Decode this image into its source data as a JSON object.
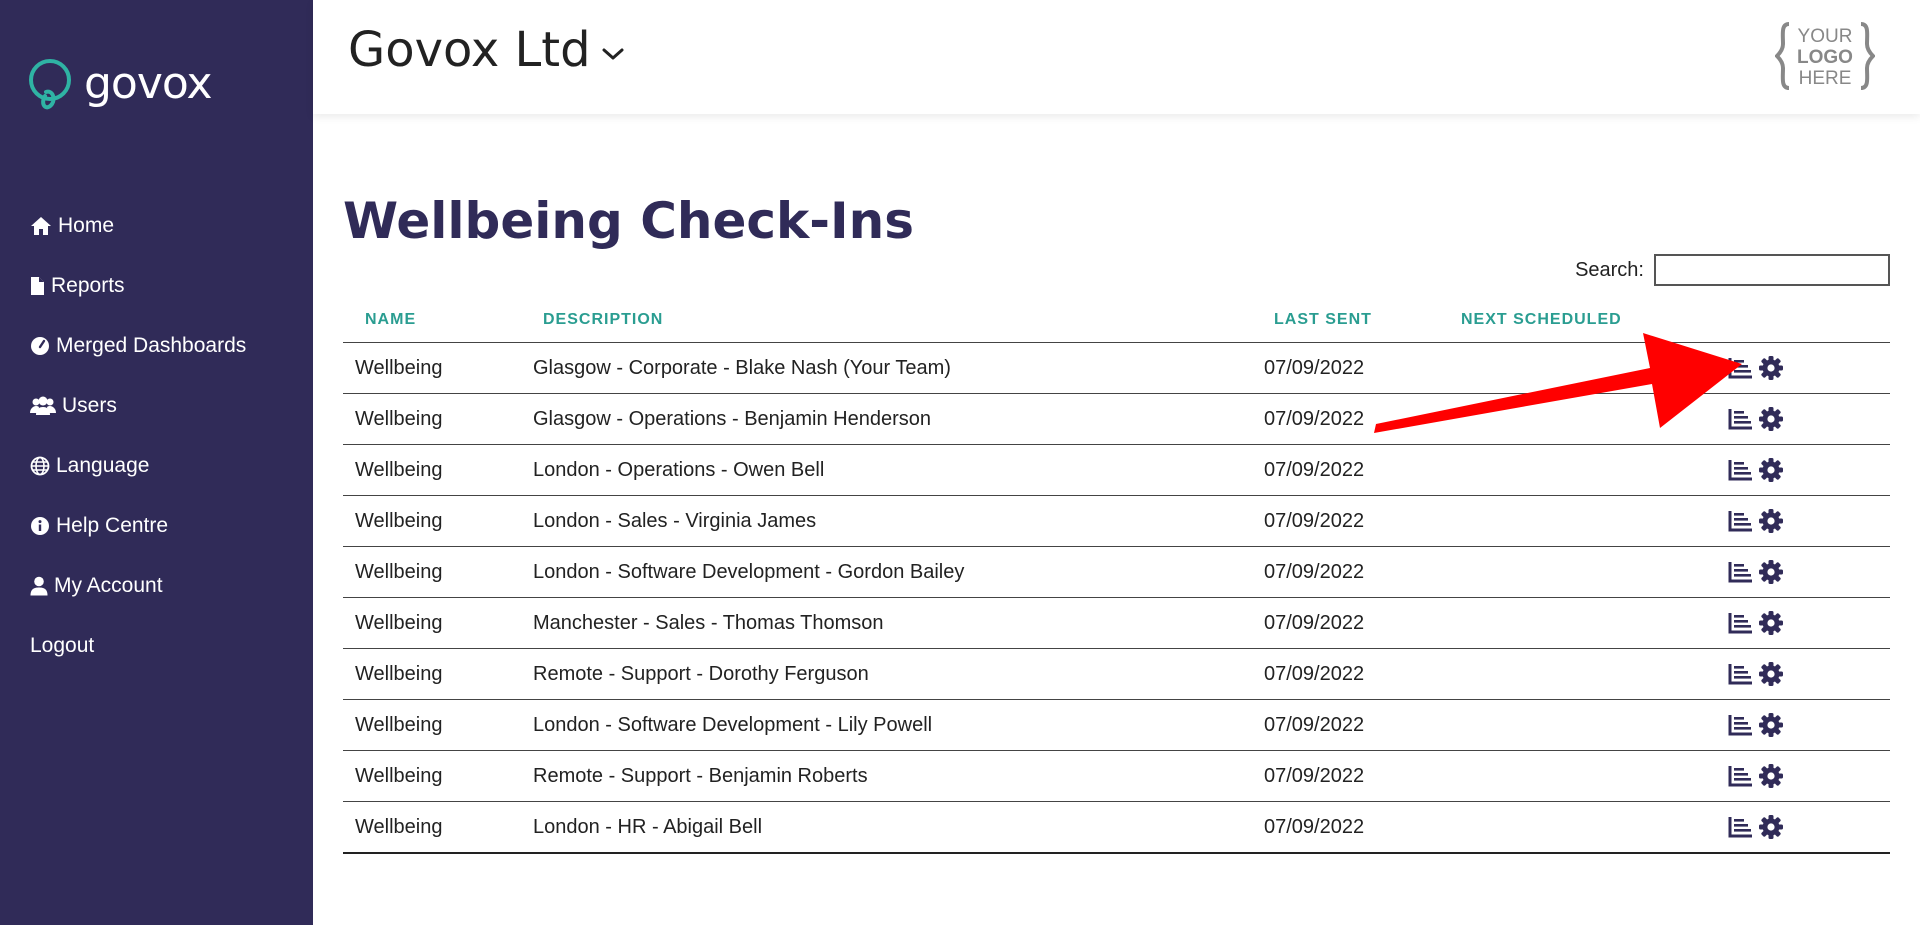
{
  "brand": {
    "name": "govox"
  },
  "sidebar": {
    "items": [
      {
        "label": "Home",
        "icon": "home-icon"
      },
      {
        "label": "Reports",
        "icon": "file-icon"
      },
      {
        "label": "Merged Dashboards",
        "icon": "gauge-icon"
      },
      {
        "label": "Users",
        "icon": "users-icon"
      },
      {
        "label": "Language",
        "icon": "globe-icon"
      },
      {
        "label": "Help Centre",
        "icon": "info-icon"
      },
      {
        "label": "My Account",
        "icon": "user-icon"
      },
      {
        "label": "Logout",
        "icon": ""
      }
    ]
  },
  "header": {
    "org_name": "Govox Ltd",
    "logo_lines": [
      "YOUR",
      "LOGO",
      "HERE"
    ]
  },
  "page": {
    "title": "Wellbeing Check-Ins"
  },
  "search": {
    "label": "Search:",
    "value": ""
  },
  "table": {
    "headers": {
      "name": "NAME",
      "description": "DESCRIPTION",
      "last_sent": "LAST SENT",
      "next_scheduled": "NEXT SCHEDULED"
    },
    "rows": [
      {
        "name": "Wellbeing",
        "description": "Glasgow - Corporate - Blake Nash (Your Team)",
        "last_sent": "07/09/2022",
        "next_scheduled": ""
      },
      {
        "name": "Wellbeing",
        "description": "Glasgow - Operations - Benjamin Henderson",
        "last_sent": "07/09/2022",
        "next_scheduled": ""
      },
      {
        "name": "Wellbeing",
        "description": "London - Operations - Owen Bell",
        "last_sent": "07/09/2022",
        "next_scheduled": ""
      },
      {
        "name": "Wellbeing",
        "description": "London - Sales - Virginia James",
        "last_sent": "07/09/2022",
        "next_scheduled": ""
      },
      {
        "name": "Wellbeing",
        "description": "London - Software Development - Gordon Bailey",
        "last_sent": "07/09/2022",
        "next_scheduled": ""
      },
      {
        "name": "Wellbeing",
        "description": "Manchester - Sales - Thomas Thomson",
        "last_sent": "07/09/2022",
        "next_scheduled": ""
      },
      {
        "name": "Wellbeing",
        "description": "Remote - Support - Dorothy Ferguson",
        "last_sent": "07/09/2022",
        "next_scheduled": ""
      },
      {
        "name": "Wellbeing",
        "description": "London - Software Development - Lily Powell",
        "last_sent": "07/09/2022",
        "next_scheduled": ""
      },
      {
        "name": "Wellbeing",
        "description": "Remote - Support - Benjamin Roberts",
        "last_sent": "07/09/2022",
        "next_scheduled": ""
      },
      {
        "name": "Wellbeing",
        "description": "London - HR - Abigail Bell",
        "last_sent": "07/09/2022",
        "next_scheduled": ""
      }
    ]
  },
  "annotation": {
    "color": "#ff0000",
    "target": "first-row-report-icon"
  },
  "colors": {
    "sidebar": "#302b58",
    "accent": "#2a9d91",
    "title": "#302b58"
  }
}
